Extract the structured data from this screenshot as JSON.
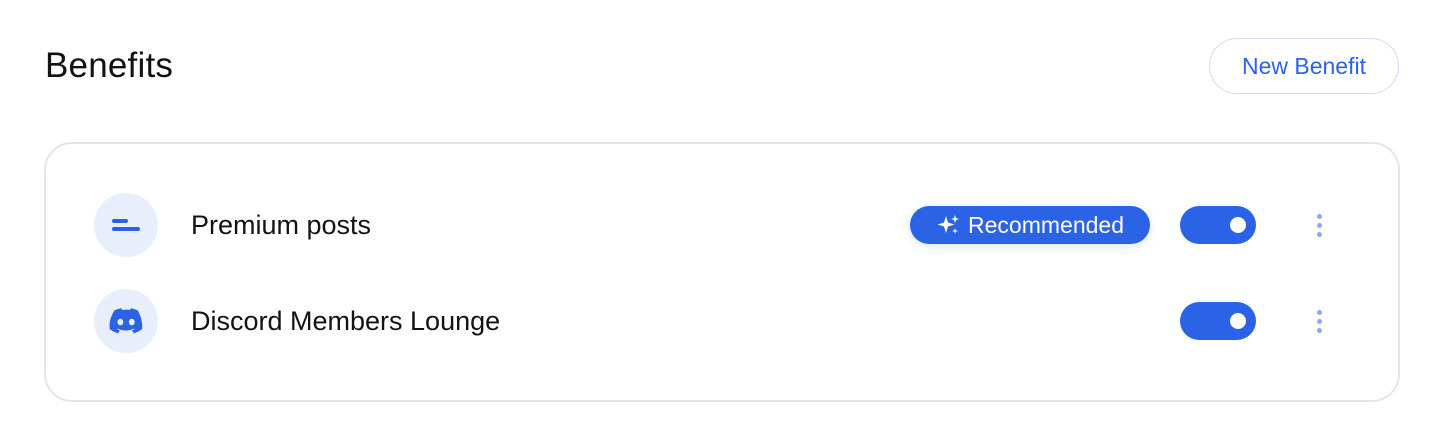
{
  "header": {
    "title": "Benefits",
    "new_benefit_label": "New Benefit"
  },
  "benefits": [
    {
      "label": "Premium posts",
      "icon": "posts-lines-icon",
      "badge": "Recommended",
      "badge_icon": "sparkle-icon",
      "enabled": true
    },
    {
      "label": "Discord Members Lounge",
      "icon": "discord-icon",
      "enabled": true
    }
  ],
  "colors": {
    "accent": "#2b63e6",
    "icon_bg": "#e8eefc",
    "border": "#e4e5ea",
    "kebab": "#8ea9ef"
  }
}
